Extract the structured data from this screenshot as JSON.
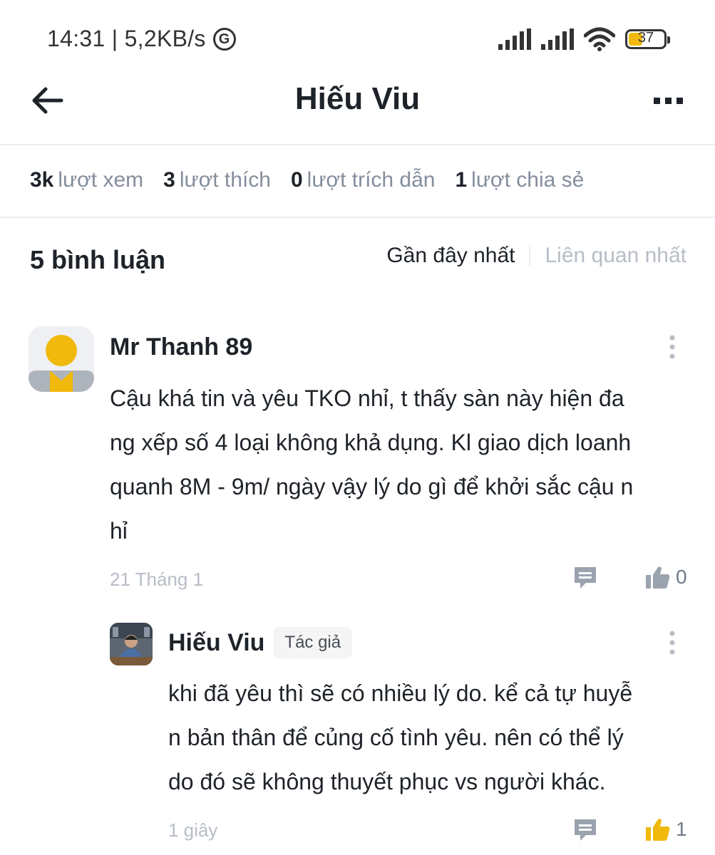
{
  "status_bar": {
    "time_speed": "14:31 | 5,2KB/s",
    "network_icon": "g-circle-icon",
    "battery_level": "37",
    "battery_fraction": 0.37
  },
  "header": {
    "title": "Hiếu Viu"
  },
  "stats": [
    {
      "value": "3k",
      "label": "lượt xem"
    },
    {
      "value": "3",
      "label": "lượt thích"
    },
    {
      "value": "0",
      "label": "lượt trích dẫn"
    },
    {
      "value": "1",
      "label": "lượt chia sẻ"
    }
  ],
  "comments_header": {
    "count_label": "5 bình luận",
    "sort_recent": "Gần đây nhất",
    "sort_relevant": "Liên quan nhất"
  },
  "comments": [
    {
      "author": "Mr Thanh 89",
      "text_lines": [
        "Cậu khá tin và yêu TKO nhỉ, t thấy sàn này hiện đa",
        "ng xếp số 4 loại không khả dụng. Kl giao dịch loanh",
        "quanh 8M - 9m/ ngày vậy lý do gì để khởi sắc cậu n",
        "hỉ"
      ],
      "time": "21 Tháng 1",
      "likes": "0",
      "liked": false
    },
    {
      "author": "Hiếu Viu",
      "badge": "Tác giả",
      "text_lines": [
        "khi đã yêu thì sẽ có nhiều lý do. kể cả tự huyễ",
        "n bản thân để củng cố tình yêu. nên có thể lý",
        "do đó sẽ không thuyết phục vs người khác."
      ],
      "time": "1 giây",
      "likes": "1",
      "liked": true
    }
  ],
  "colors": {
    "accent": "#f0b90b",
    "text_primary": "#1e2329",
    "text_secondary": "#848e9c",
    "text_muted": "#b7bdc6",
    "icon_gray": "#9aa3ae"
  }
}
